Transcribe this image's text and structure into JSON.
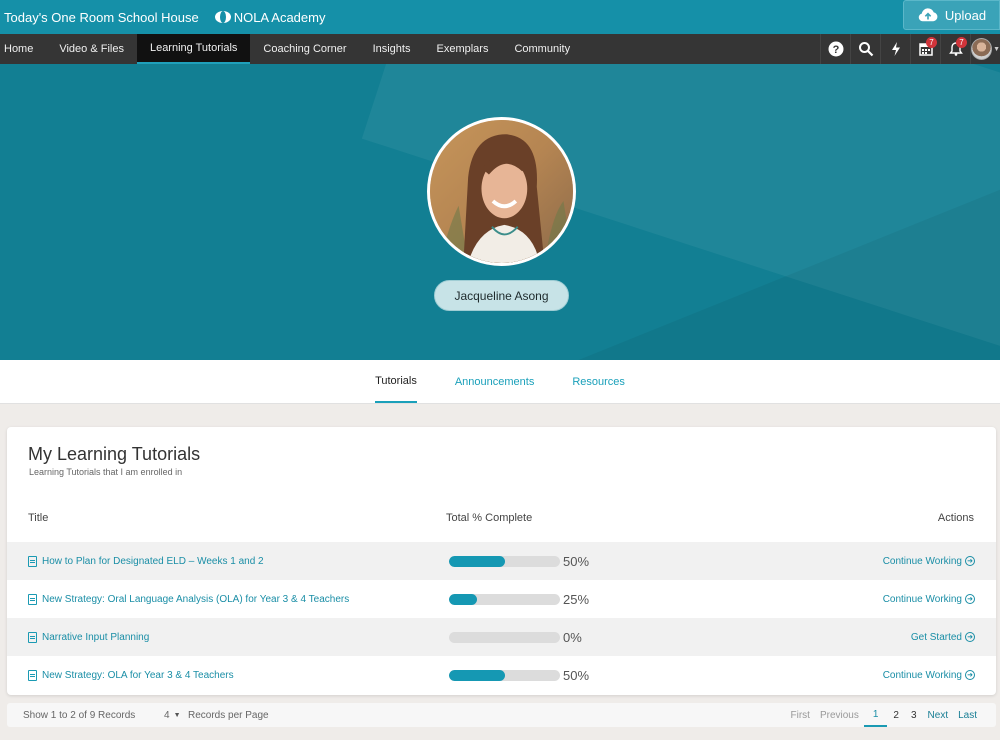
{
  "header": {
    "site_name": "Today's One Room School House",
    "org_name": "NOLA Academy",
    "upload_label": "Upload"
  },
  "nav": {
    "items": [
      {
        "label": "Home"
      },
      {
        "label": "Video & Files"
      },
      {
        "label": "Learning Tutorials",
        "active": true
      },
      {
        "label": "Coaching Corner"
      },
      {
        "label": "Insights"
      },
      {
        "label": "Exemplars"
      },
      {
        "label": "Community"
      }
    ],
    "icons": [
      "help-icon",
      "search-icon",
      "lightning-icon",
      "calendar-icon",
      "bell-icon"
    ],
    "calendar_badge": "7",
    "bell_badge": "7"
  },
  "profile": {
    "name": "Jacqueline Asong"
  },
  "subtabs": [
    {
      "label": "Tutorials",
      "active": true
    },
    {
      "label": "Announcements"
    },
    {
      "label": "Resources"
    }
  ],
  "tutorials": {
    "title": "My Learning Tutorials",
    "subtitle": "Learning Tutorials that I am enrolled in",
    "columns": {
      "title": "Title",
      "complete": "Total % Complete",
      "actions": "Actions"
    },
    "rows": [
      {
        "title": "How to Plan for Designated ELD – Weeks 1 and 2",
        "percent": 50,
        "percent_label": "50%",
        "action": "Continue Working"
      },
      {
        "title": "New Strategy: Oral Language Analysis (OLA) for Year 3 & 4 Teachers",
        "percent": 25,
        "percent_label": "25%",
        "action": "Continue Working"
      },
      {
        "title": "Narrative Input Planning",
        "percent": 0,
        "percent_label": "0%",
        "action": "Get Started"
      },
      {
        "title": "New Strategy: OLA for Year 3 & 4 Teachers",
        "percent": 50,
        "percent_label": "50%",
        "action": "Continue Working"
      }
    ]
  },
  "pagination": {
    "records_text": "Show 1 to 2 of 9 Records",
    "per_page_value": "4",
    "per_page_label": "Records per Page",
    "first": "First",
    "previous": "Previous",
    "pages": [
      "1",
      "2",
      "3"
    ],
    "current_page": "1",
    "next": "Next",
    "last": "Last"
  },
  "colors": {
    "brand": "#1590a8",
    "nav_bg": "#353535",
    "accent": "#1598b3",
    "hero": "#127f93"
  }
}
